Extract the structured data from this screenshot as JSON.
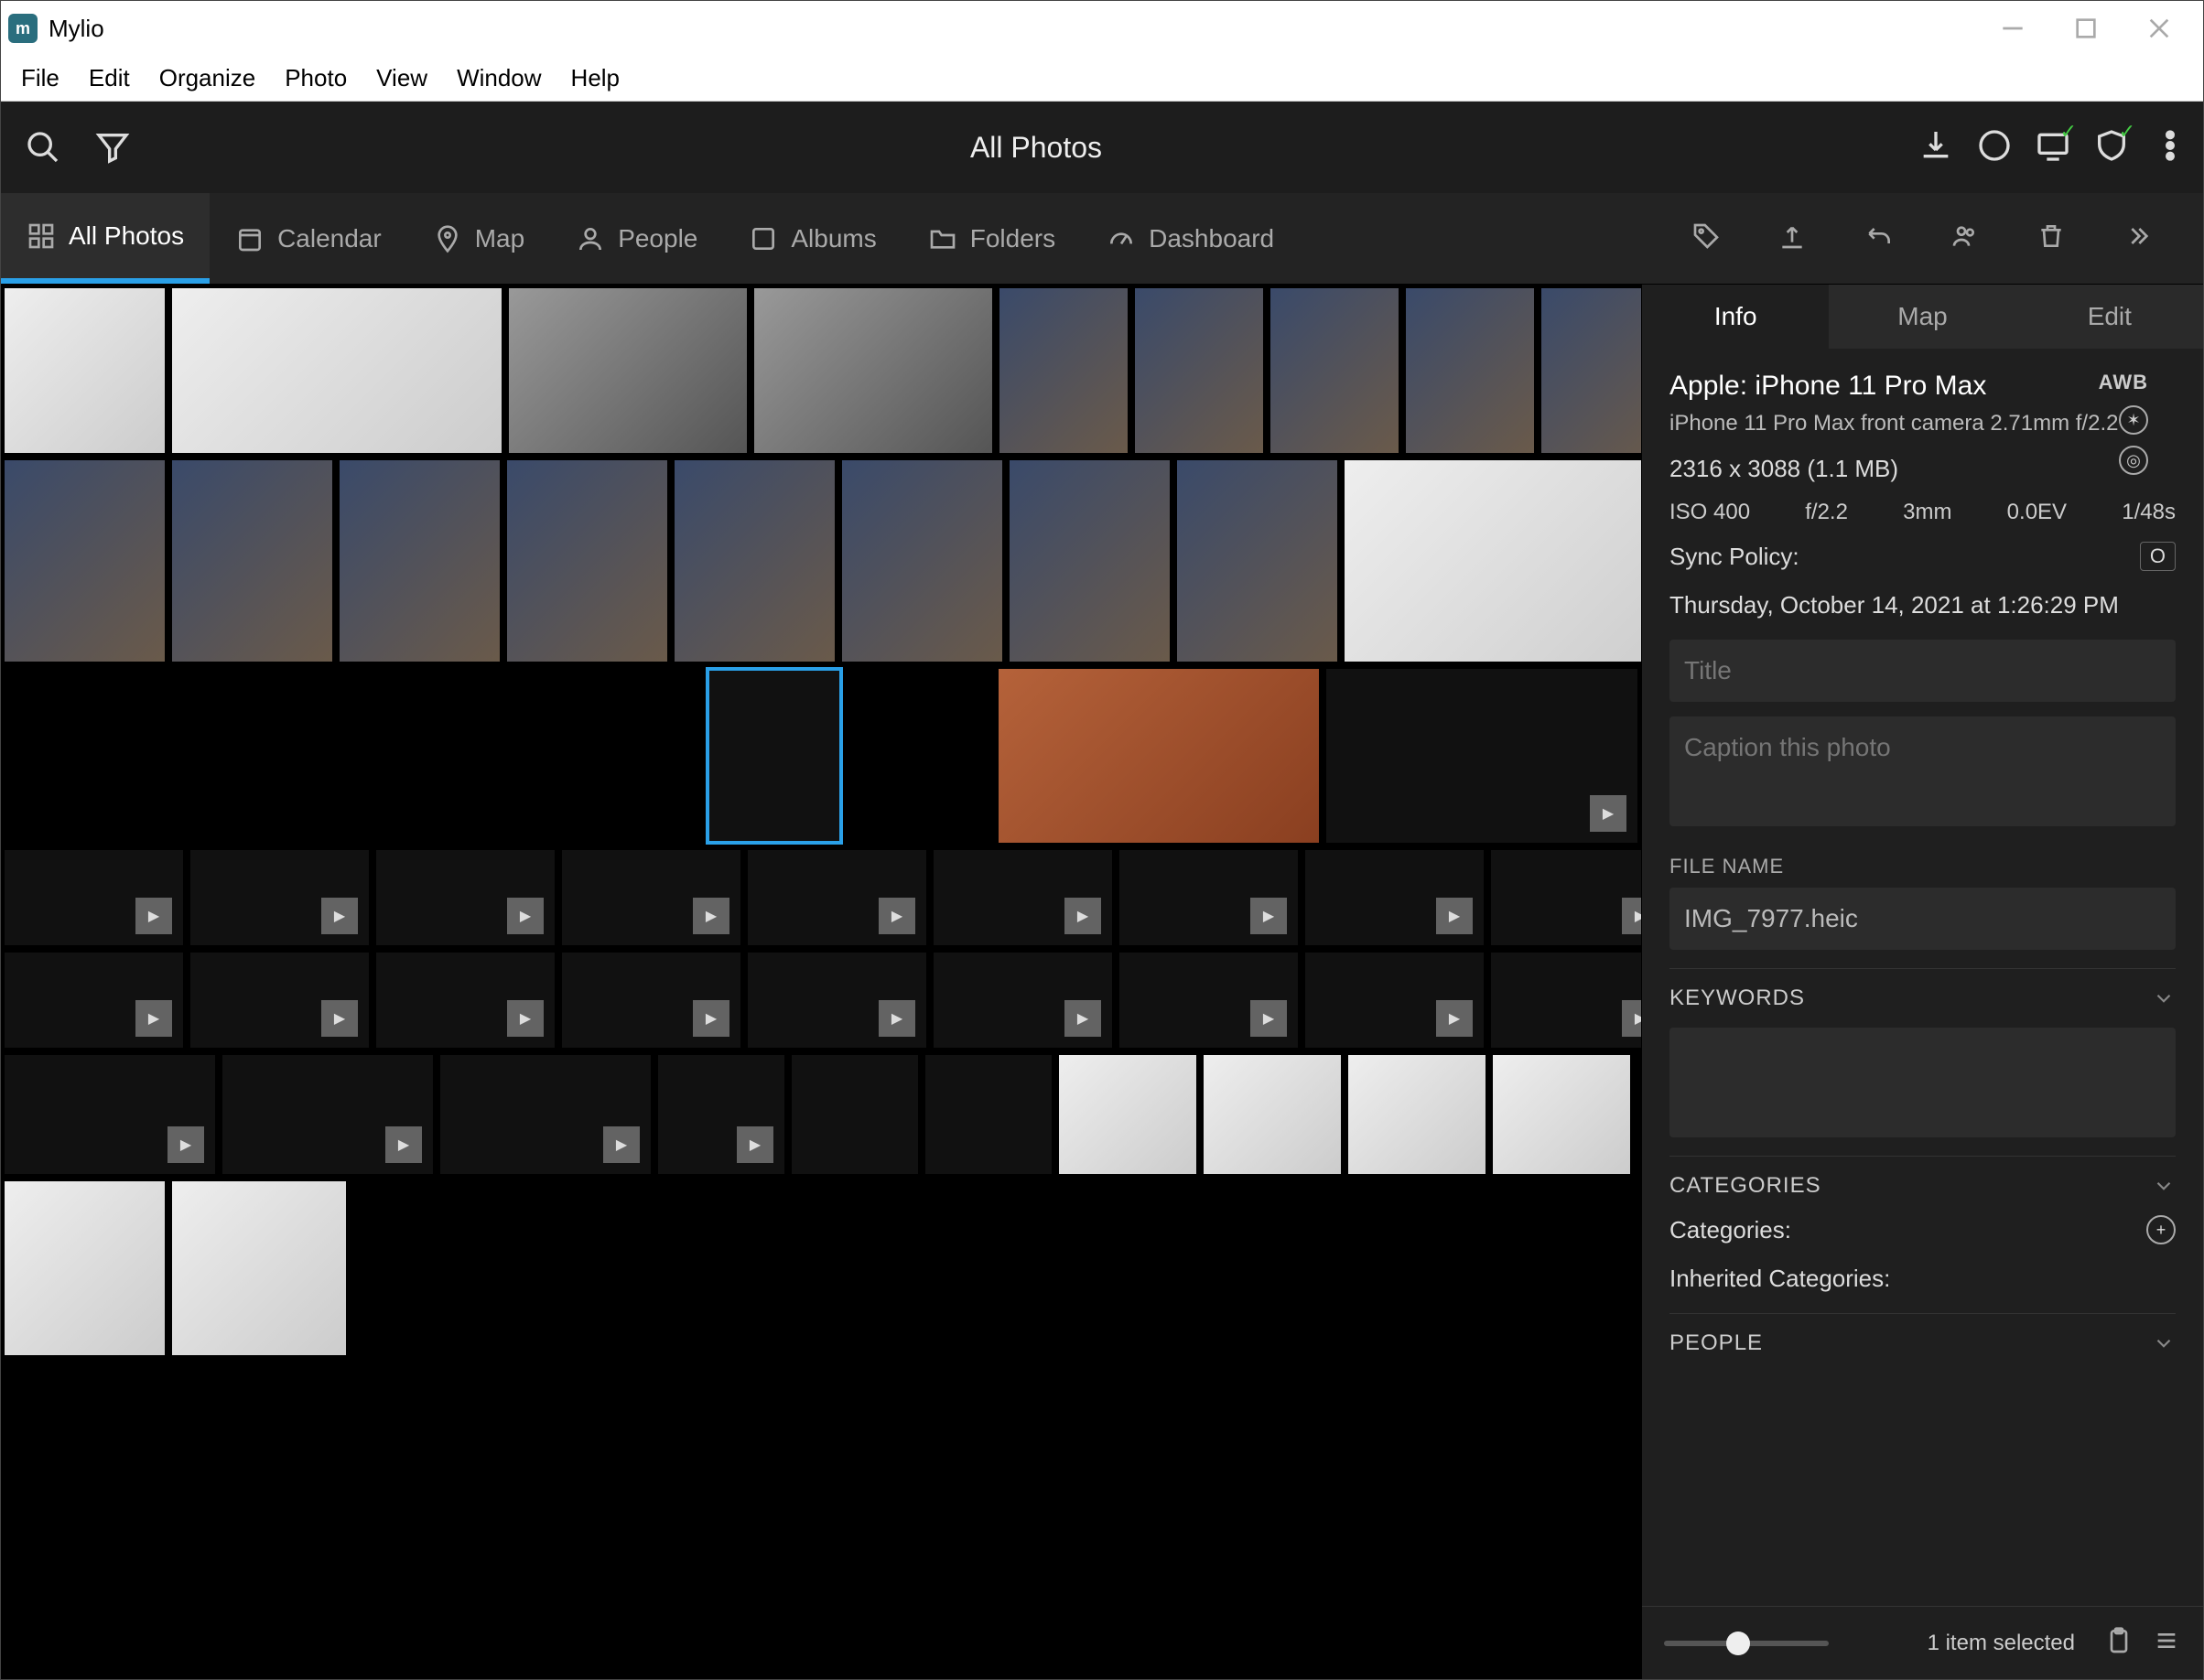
{
  "app": {
    "name": "Mylio"
  },
  "menubar": [
    "File",
    "Edit",
    "Organize",
    "Photo",
    "View",
    "Window",
    "Help"
  ],
  "topbar": {
    "title": "All Photos"
  },
  "navtabs": [
    {
      "label": "All Photos",
      "icon": "grid",
      "active": true
    },
    {
      "label": "Calendar",
      "icon": "calendar"
    },
    {
      "label": "Map",
      "icon": "pin"
    },
    {
      "label": "People",
      "icon": "person"
    },
    {
      "label": "Albums",
      "icon": "album"
    },
    {
      "label": "Folders",
      "icon": "folder"
    },
    {
      "label": "Dashboard",
      "icon": "gauge"
    }
  ],
  "side": {
    "tabs": [
      "Info",
      "Map",
      "Edit"
    ],
    "active_tab": "Info",
    "camera_make_model": "Apple: iPhone 11 Pro Max",
    "lens": "iPhone 11 Pro Max front camera 2.71mm f/2.2",
    "dimensions": "2316 x 3088 (1.1 MB)",
    "awb": "AWB",
    "meta": {
      "iso": "ISO 400",
      "aperture": "f/2.2",
      "focal": "3mm",
      "ev": "0.0EV",
      "shutter": "1/48s"
    },
    "sync_policy_label": "Sync Policy:",
    "sync_badge": "O",
    "datetime": "Thursday, October 14, 2021 at 1:26:29 PM",
    "title_placeholder": "Title",
    "caption_placeholder": "Caption this photo",
    "filename_label": "FILE NAME",
    "filename": "IMG_7977.heic",
    "keywords_label": "KEYWORDS",
    "categories_label": "CATEGORIES",
    "categories_row": "Categories:",
    "inherited_row": "Inherited Categories:",
    "people_label": "PEOPLE"
  },
  "footer": {
    "selection": "1 item selected"
  }
}
